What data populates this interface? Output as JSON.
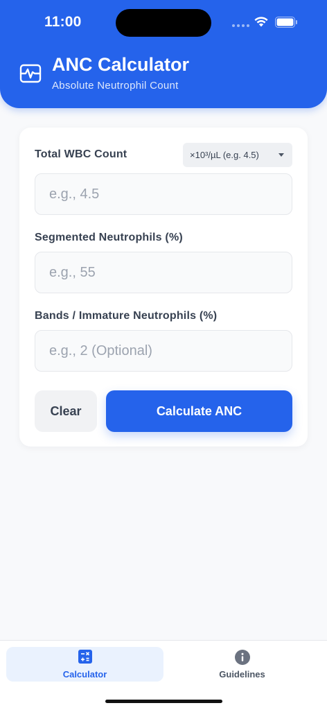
{
  "status_bar": {
    "time": "11:00"
  },
  "header": {
    "title": "ANC Calculator",
    "subtitle": "Absolute Neutrophil Count",
    "icon": "heart-pulse-monitor-icon"
  },
  "form": {
    "wbc": {
      "label": "Total WBC Count",
      "unit_selected": "×10³/µL (e.g. 4.5)",
      "value": "",
      "placeholder": "e.g., 4.5"
    },
    "segs": {
      "label": "Segmented Neutrophils (%)",
      "value": "",
      "placeholder": "e.g., 55"
    },
    "bands": {
      "label": "Bands / Immature Neutrophils (%)",
      "value": "",
      "placeholder": "e.g., 2 (Optional)"
    },
    "clear_label": "Clear",
    "calculate_label": "Calculate ANC"
  },
  "tabs": [
    {
      "label": "Calculator",
      "icon": "calculator-icon",
      "active": true
    },
    {
      "label": "Guidelines",
      "icon": "info-icon",
      "active": false
    }
  ],
  "colors": {
    "accent": "#2563eb",
    "background": "#f8f9fb",
    "card": "#ffffff"
  }
}
